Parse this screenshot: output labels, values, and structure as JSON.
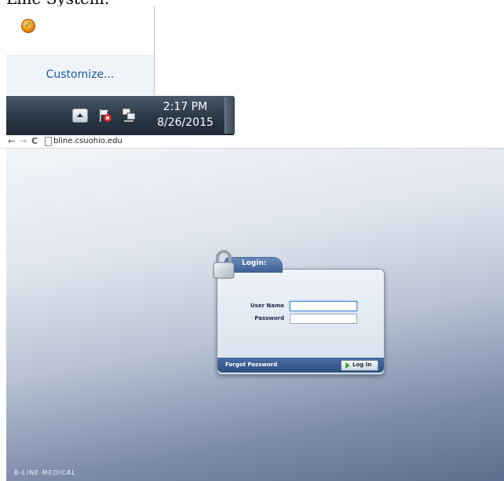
{
  "caption": "Line System.",
  "tray_popup": {
    "customize_label": "Customize..."
  },
  "taskbar": {
    "time": "2:17 PM",
    "date": "8/26/2015"
  },
  "browser": {
    "back": "←",
    "forward": "→",
    "reload": "C",
    "url": "bline.csuohio.edu"
  },
  "login": {
    "title": "Login:",
    "username_label": "User Name",
    "password_label": "Password",
    "username_value": "",
    "password_value": "",
    "forgot_label": "Forgot Password",
    "login_button": "Log In"
  },
  "footer": {
    "logo": "B-LINE MEDICAL"
  },
  "colors": {
    "taskbar": "#2c3948",
    "login_header": "#3c5f95",
    "link": "#1e5aa8"
  }
}
